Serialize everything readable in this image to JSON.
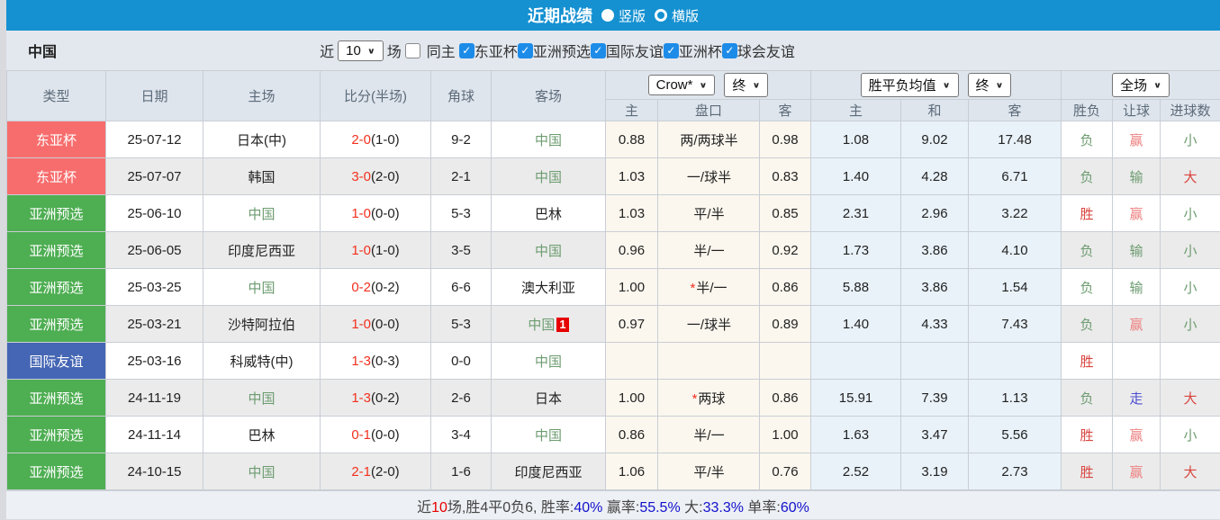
{
  "colors": {
    "topbar_blue": "#1591d1",
    "type_red": "#f76d6d",
    "type_green": "#4eae52",
    "type_blue": "#4566b4",
    "china_green": "#6d9c70",
    "score_red": "#f3301e",
    "result_red": "#d9453f",
    "handicap_win_pink": "#ee8181",
    "walk_blue": "#4d4fd2",
    "percent_blue": "#1111cc",
    "handicap_odds_bg": "#fbf7ee",
    "avg_odds_bg": "#e9f2f9",
    "checkbox_blue": "#1d8ce8"
  },
  "title_bar": {
    "title": "近期战绩",
    "vertical_label": "竖版",
    "horizontal_label": "横版",
    "selected": "竖版"
  },
  "filter_bar": {
    "team": "中国",
    "recent_prefix": "近",
    "recent_value": "10",
    "recent_suffix": "场",
    "same_home": {
      "label": "同主",
      "checked": false
    },
    "competitions": [
      {
        "label": "东亚杯",
        "checked": true
      },
      {
        "label": "亚洲预选",
        "checked": true
      },
      {
        "label": "国际友谊",
        "checked": true
      },
      {
        "label": "亚洲杯",
        "checked": true
      },
      {
        "label": "球会友谊",
        "checked": true
      }
    ]
  },
  "table": {
    "left_headers": [
      "类型",
      "日期",
      "主场",
      "比分(半场)",
      "角球",
      "客场"
    ],
    "selects": {
      "odds_company": "Crow*",
      "odds_stage": "终",
      "avg_type": "胜平负均值",
      "avg_stage": "终",
      "scope": "全场"
    },
    "sub_headers": [
      "主",
      "盘口",
      "客",
      "主",
      "和",
      "客",
      "胜负",
      "让球",
      "进球数"
    ],
    "rows": [
      {
        "type": "东亚杯",
        "type_color": "red",
        "date": "25-07-12",
        "home": "日本(中)",
        "home_china": false,
        "score": "2-0",
        "half": "(1-0)",
        "corners": "9-2",
        "away": "中国",
        "away_china": true,
        "away_badge": "",
        "odds_home": "0.88",
        "handicap": "两/两球半",
        "handicap_star": false,
        "odds_away": "0.98",
        "avg_win": "1.08",
        "avg_draw": "9.02",
        "avg_lose": "17.48",
        "result": "负",
        "result_color": "green",
        "handicap_result": "赢",
        "handicap_result_color": "pink",
        "goals": "小",
        "goals_color": "green"
      },
      {
        "type": "东亚杯",
        "type_color": "red",
        "date": "25-07-07",
        "home": "韩国",
        "home_china": false,
        "score": "3-0",
        "half": "(2-0)",
        "corners": "2-1",
        "away": "中国",
        "away_china": true,
        "away_badge": "",
        "odds_home": "1.03",
        "handicap": "一/球半",
        "handicap_star": false,
        "odds_away": "0.83",
        "avg_win": "1.40",
        "avg_draw": "4.28",
        "avg_lose": "6.71",
        "result": "负",
        "result_color": "green",
        "handicap_result": "输",
        "handicap_result_color": "green",
        "goals": "大",
        "goals_color": "red"
      },
      {
        "type": "亚洲预选",
        "type_color": "green",
        "date": "25-06-10",
        "home": "中国",
        "home_china": true,
        "score": "1-0",
        "half": "(0-0)",
        "corners": "5-3",
        "away": "巴林",
        "away_china": false,
        "away_badge": "",
        "odds_home": "1.03",
        "handicap": "平/半",
        "handicap_star": false,
        "odds_away": "0.85",
        "avg_win": "2.31",
        "avg_draw": "2.96",
        "avg_lose": "3.22",
        "result": "胜",
        "result_color": "red",
        "handicap_result": "赢",
        "handicap_result_color": "pink",
        "goals": "小",
        "goals_color": "green"
      },
      {
        "type": "亚洲预选",
        "type_color": "green",
        "date": "25-06-05",
        "home": "印度尼西亚",
        "home_china": false,
        "score": "1-0",
        "half": "(1-0)",
        "corners": "3-5",
        "away": "中国",
        "away_china": true,
        "away_badge": "",
        "odds_home": "0.96",
        "handicap": "半/一",
        "handicap_star": false,
        "odds_away": "0.92",
        "avg_win": "1.73",
        "avg_draw": "3.86",
        "avg_lose": "4.10",
        "result": "负",
        "result_color": "green",
        "handicap_result": "输",
        "handicap_result_color": "green",
        "goals": "小",
        "goals_color": "green"
      },
      {
        "type": "亚洲预选",
        "type_color": "green",
        "date": "25-03-25",
        "home": "中国",
        "home_china": true,
        "score": "0-2",
        "half": "(0-2)",
        "corners": "6-6",
        "away": "澳大利亚",
        "away_china": false,
        "away_badge": "",
        "odds_home": "1.00",
        "handicap": "半/一",
        "handicap_star": true,
        "odds_away": "0.86",
        "avg_win": "5.88",
        "avg_draw": "3.86",
        "avg_lose": "1.54",
        "result": "负",
        "result_color": "green",
        "handicap_result": "输",
        "handicap_result_color": "green",
        "goals": "小",
        "goals_color": "green"
      },
      {
        "type": "亚洲预选",
        "type_color": "green",
        "date": "25-03-21",
        "home": "沙特阿拉伯",
        "home_china": false,
        "score": "1-0",
        "half": "(0-0)",
        "corners": "5-3",
        "away": "中国",
        "away_china": true,
        "away_badge": "1",
        "odds_home": "0.97",
        "handicap": "一/球半",
        "handicap_star": false,
        "odds_away": "0.89",
        "avg_win": "1.40",
        "avg_draw": "4.33",
        "avg_lose": "7.43",
        "result": "负",
        "result_color": "green",
        "handicap_result": "赢",
        "handicap_result_color": "pink",
        "goals": "小",
        "goals_color": "green"
      },
      {
        "type": "国际友谊",
        "type_color": "blue",
        "date": "25-03-16",
        "home": "科威特(中)",
        "home_china": false,
        "score": "1-3",
        "half": "(0-3)",
        "corners": "0-0",
        "away": "中国",
        "away_china": true,
        "away_badge": "",
        "odds_home": "",
        "handicap": "",
        "handicap_star": false,
        "odds_away": "",
        "avg_win": "",
        "avg_draw": "",
        "avg_lose": "",
        "result": "胜",
        "result_color": "red",
        "handicap_result": "",
        "handicap_result_color": "",
        "goals": "",
        "goals_color": ""
      },
      {
        "type": "亚洲预选",
        "type_color": "green",
        "date": "24-11-19",
        "home": "中国",
        "home_china": true,
        "score": "1-3",
        "half": "(0-2)",
        "corners": "2-6",
        "away": "日本",
        "away_china": false,
        "away_badge": "",
        "odds_home": "1.00",
        "handicap": "两球",
        "handicap_star": true,
        "odds_away": "0.86",
        "avg_win": "15.91",
        "avg_draw": "7.39",
        "avg_lose": "1.13",
        "result": "负",
        "result_color": "green",
        "handicap_result": "走",
        "handicap_result_color": "blue",
        "goals": "大",
        "goals_color": "red"
      },
      {
        "type": "亚洲预选",
        "type_color": "green",
        "date": "24-11-14",
        "home": "巴林",
        "home_china": false,
        "score": "0-1",
        "half": "(0-0)",
        "corners": "3-4",
        "away": "中国",
        "away_china": true,
        "away_badge": "",
        "odds_home": "0.86",
        "handicap": "半/一",
        "handicap_star": false,
        "odds_away": "1.00",
        "avg_win": "1.63",
        "avg_draw": "3.47",
        "avg_lose": "5.56",
        "result": "胜",
        "result_color": "red",
        "handicap_result": "赢",
        "handicap_result_color": "pink",
        "goals": "小",
        "goals_color": "green"
      },
      {
        "type": "亚洲预选",
        "type_color": "green",
        "date": "24-10-15",
        "home": "中国",
        "home_china": true,
        "score": "2-1",
        "half": "(2-0)",
        "corners": "1-6",
        "away": "印度尼西亚",
        "away_china": false,
        "away_badge": "",
        "odds_home": "1.06",
        "handicap": "平/半",
        "handicap_star": false,
        "odds_away": "0.76",
        "avg_win": "2.52",
        "avg_draw": "3.19",
        "avg_lose": "2.73",
        "result": "胜",
        "result_color": "red",
        "handicap_result": "赢",
        "handicap_result_color": "pink",
        "goals": "大",
        "goals_color": "red"
      }
    ]
  },
  "summary": {
    "parts": [
      {
        "text": "近",
        "color": "dark"
      },
      {
        "text": "10",
        "color": "red"
      },
      {
        "text": "场,胜4平0负6, 胜率:",
        "color": "dark"
      },
      {
        "text": "40%",
        "color": "blue"
      },
      {
        "text": " 赢率:",
        "color": "dark"
      },
      {
        "text": "55.5%",
        "color": "blue"
      },
      {
        "text": " 大:",
        "color": "dark"
      },
      {
        "text": "33.3%",
        "color": "blue"
      },
      {
        "text": " 单率:",
        "color": "dark"
      },
      {
        "text": "60%",
        "color": "blue"
      }
    ]
  }
}
